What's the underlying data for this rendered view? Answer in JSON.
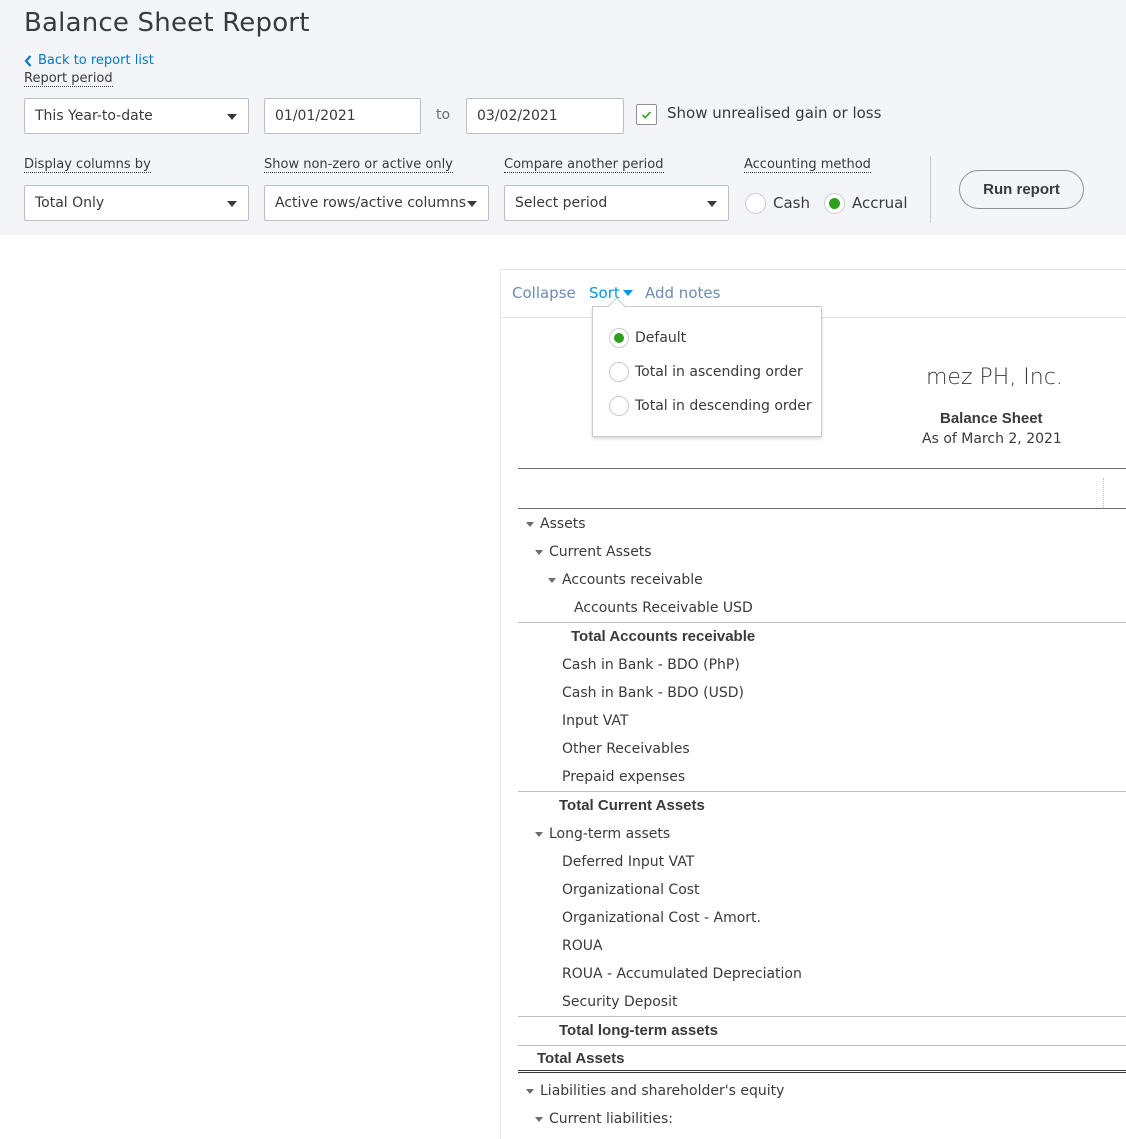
{
  "header": {
    "title": "Balance Sheet Report",
    "back_link": "Back to report list"
  },
  "filters": {
    "report_period": {
      "label": "Report period",
      "selected": "This Year-to-date",
      "from": "01/01/2021",
      "to_label": "to",
      "to": "03/02/2021"
    },
    "unrealised": {
      "label": "Show unrealised gain or loss",
      "checked": true
    },
    "display_columns": {
      "label": "Display columns by",
      "selected": "Total Only"
    },
    "non_zero": {
      "label": "Show non-zero or active only",
      "selected": "Active rows/active columns"
    },
    "compare": {
      "label": "Compare another period",
      "selected": "Select period"
    },
    "accounting_method": {
      "label": "Accounting method",
      "options": [
        "Cash",
        "Accrual"
      ],
      "selected": "Accrual"
    },
    "run_button": "Run report"
  },
  "toolbar": {
    "collapse": "Collapse",
    "sort": "Sort",
    "add_notes": "Add notes"
  },
  "sort_menu": {
    "options": [
      "Default",
      "Total in ascending order",
      "Total in descending order"
    ],
    "selected": "Default"
  },
  "report": {
    "company": "mez PH, Inc.",
    "title": "Balance Sheet",
    "date": "As of March 2, 2021",
    "rows": [
      {
        "label": "Assets",
        "type": "section"
      },
      {
        "label": "Current Assets",
        "type": "section"
      },
      {
        "label": "Accounts receivable",
        "type": "section"
      },
      {
        "label": "Accounts Receivable USD",
        "type": "item"
      },
      {
        "label": "Total Accounts receivable",
        "type": "total"
      },
      {
        "label": "Cash in Bank - BDO (PhP)",
        "type": "item"
      },
      {
        "label": "Cash in Bank - BDO (USD)",
        "type": "item"
      },
      {
        "label": "Input VAT",
        "type": "item"
      },
      {
        "label": "Other Receivables",
        "type": "item"
      },
      {
        "label": "Prepaid expenses",
        "type": "item"
      },
      {
        "label": "Total Current Assets",
        "type": "total"
      },
      {
        "label": "Long-term assets",
        "type": "section"
      },
      {
        "label": "Deferred Input VAT",
        "type": "item"
      },
      {
        "label": "Organizational Cost",
        "type": "item"
      },
      {
        "label": "Organizational Cost - Amort.",
        "type": "item"
      },
      {
        "label": "ROUA",
        "type": "item"
      },
      {
        "label": "ROUA - Accumulated Depreciation",
        "type": "item"
      },
      {
        "label": "Security Deposit",
        "type": "item"
      },
      {
        "label": "Total long-term assets",
        "type": "total"
      },
      {
        "label": "Total Assets",
        "type": "total"
      },
      {
        "label": "Liabilities and shareholder's equity",
        "type": "section"
      },
      {
        "label": "Current liabilities:",
        "type": "section"
      }
    ]
  }
}
